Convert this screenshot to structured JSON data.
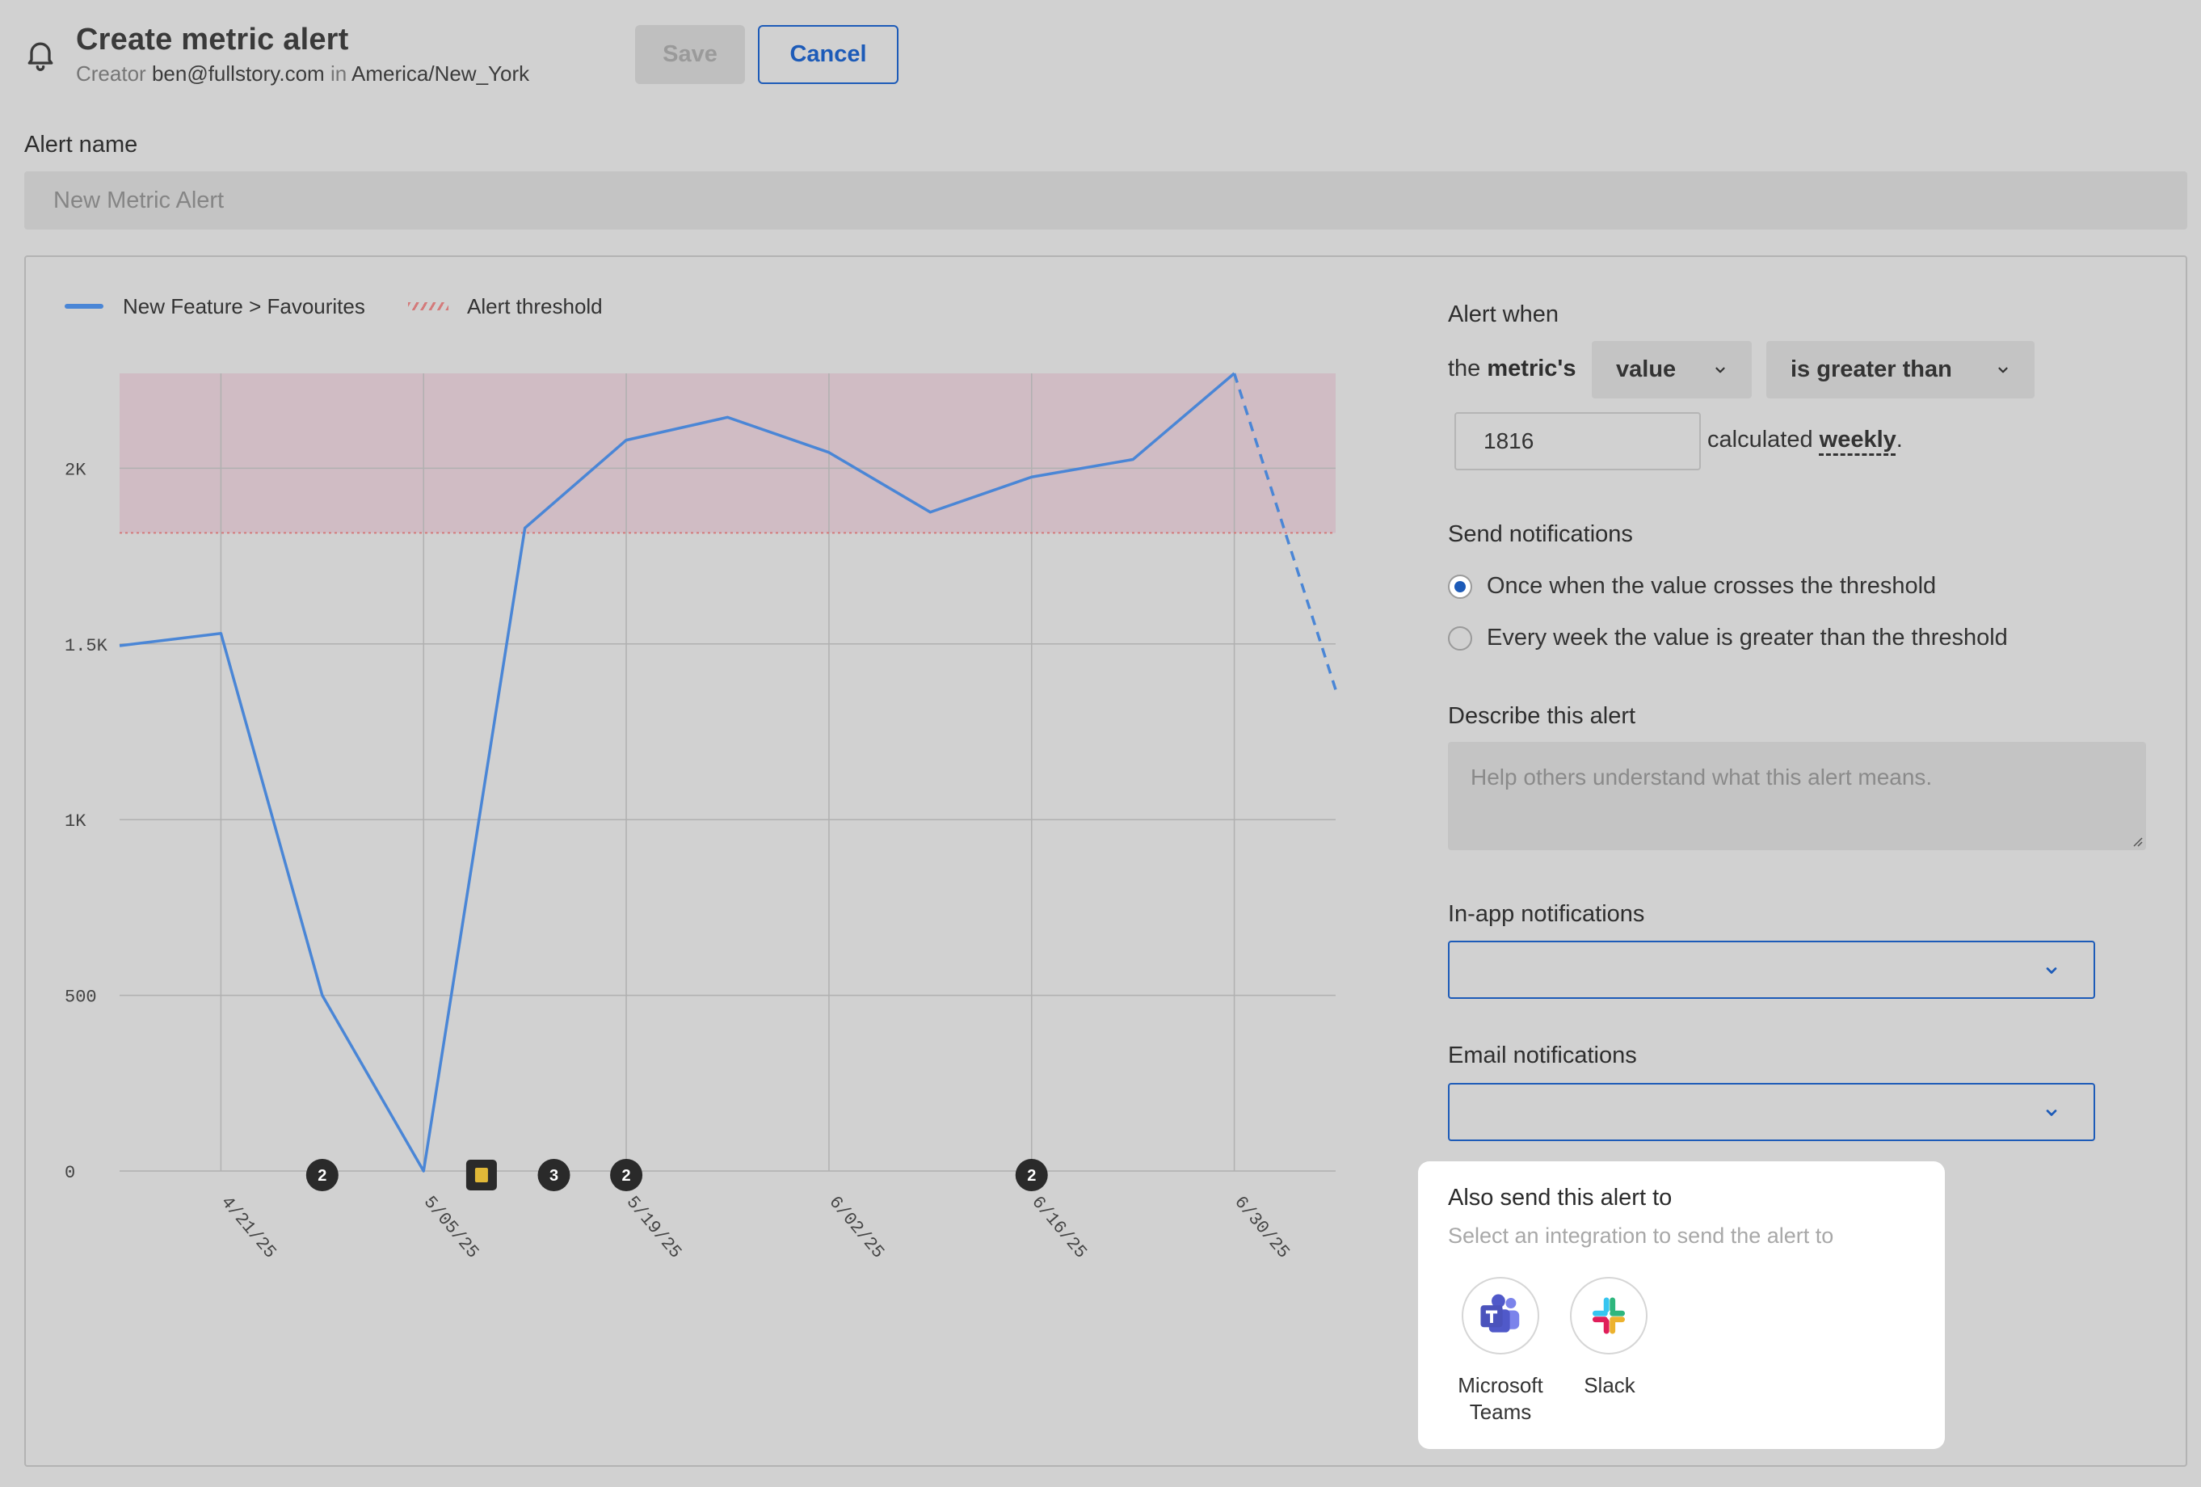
{
  "header": {
    "title": "Create metric alert",
    "creator_prefix": "Creator",
    "creator_email": "ben@fullstory.com",
    "in_word": "in",
    "timezone": "America/New_York",
    "save_label": "Save",
    "cancel_label": "Cancel",
    "icon": "bell-icon"
  },
  "alert_name": {
    "label": "Alert name",
    "placeholder": "New Metric Alert",
    "value": ""
  },
  "legend": {
    "series": "New Feature > Favourites",
    "threshold": "Alert threshold"
  },
  "chart_data": {
    "type": "line",
    "x": [
      "4/14/25",
      "4/21/25",
      "4/28/25",
      "5/05/25",
      "5/12/25",
      "5/19/25",
      "5/26/25",
      "6/02/25",
      "6/09/25",
      "6/16/25",
      "6/23/25",
      "6/30/25",
      "7/07/25"
    ],
    "x_tick_labels": [
      "4/21/25",
      "5/05/25",
      "5/19/25",
      "6/02/25",
      "6/16/25",
      "6/30/25"
    ],
    "series": [
      {
        "name": "New Feature > Favourites",
        "color": "#4a86d6",
        "values": [
          1495,
          1530,
          500,
          0,
          1830,
          2080,
          2145,
          2045,
          1875,
          1975,
          2025,
          2270,
          1370
        ],
        "dashed_from_index": 11
      }
    ],
    "threshold": {
      "name": "Alert threshold",
      "value": 1816,
      "color": "#d47a7a",
      "fill": "#d0bcc4"
    },
    "y_ticks": [
      0,
      500,
      1000,
      1500,
      2000
    ],
    "y_tick_labels": [
      "0",
      "500",
      "1K",
      "1.5K",
      "2K"
    ],
    "ylim": [
      0,
      2270
    ],
    "grid": true,
    "legend_position": "top-left",
    "annotations": [
      {
        "label": "2",
        "x": "4/28/25",
        "kind": "count"
      },
      {
        "label": "",
        "x": "5/09/25",
        "kind": "note"
      },
      {
        "label": "3",
        "x": "5/14/25",
        "kind": "count"
      },
      {
        "label": "2",
        "x": "5/19/25",
        "kind": "count"
      },
      {
        "label": "2",
        "x": "6/16/25",
        "kind": "count"
      }
    ]
  },
  "alert_when": {
    "label": "Alert when",
    "the_text": "the",
    "metrics_text": "metric's",
    "aggregation": "value",
    "comparison": "is greater than",
    "threshold_value": "1816",
    "calculated_text": "calculated",
    "period": "weekly",
    "period_suffix": "."
  },
  "send_notifications": {
    "label": "Send notifications",
    "options": [
      {
        "label": "Once when the value crosses the threshold",
        "checked": true
      },
      {
        "label": "Every week the value is greater than the threshold",
        "checked": false
      }
    ]
  },
  "describe": {
    "label": "Describe this alert",
    "placeholder": "Help others understand what this alert means."
  },
  "in_app": {
    "label": "In-app notifications",
    "value": ""
  },
  "email": {
    "label": "Email notifications",
    "value": ""
  },
  "integrations": {
    "title": "Also send this alert to",
    "subtitle": "Select an integration to send the alert to",
    "items": [
      {
        "name": "Microsoft Teams",
        "line1": "Microsoft",
        "line2": "Teams",
        "icon": "microsoft-teams-icon"
      },
      {
        "name": "Slack",
        "line1": "Slack",
        "icon": "slack-icon"
      }
    ]
  },
  "colors": {
    "accent": "#1d5bb8",
    "line": "#4a86d6",
    "threshold": "#d47a7a",
    "background": "#d1d1d1"
  }
}
